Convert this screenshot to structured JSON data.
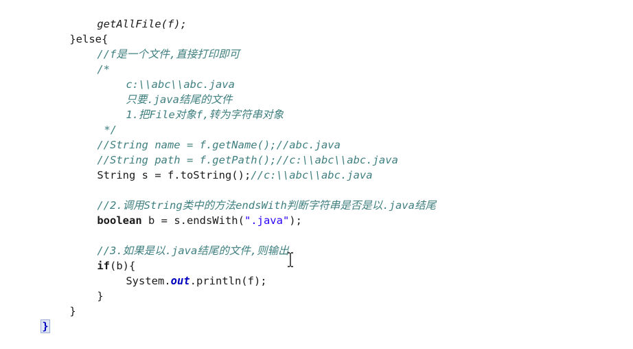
{
  "code": {
    "l1_call": "getAllFile(f);",
    "l2_else": "}else{",
    "l3_comment": "//f是一个文件,直接打印即可",
    "l4_open": "/*",
    "l5": "c:\\\\abc\\\\abc.java",
    "l6": "只要.java结尾的文件",
    "l7": "1.把File对象f,转为字符串对象",
    "l8_close": "*/",
    "l9": "//String name = f.getName();//abc.java",
    "l10": "//String path = f.getPath();//c:\\\\abc\\\\abc.java",
    "l11_code": "String s = f.toString();",
    "l11_comment": "//c:\\\\abc\\\\abc.java",
    "l13": "//2.调用String类中的方法endsWith判断字符串是否是以.java结尾",
    "l14_kw": "boolean",
    "l14_code": " b = s.endsWith(",
    "l14_str": "\".java\"",
    "l14_end": ");",
    "l16": "//3.如果是以.java结尾的文件,则输出",
    "l17_kw": "if",
    "l17_code": "(b){",
    "l18_a": "System.",
    "l18_field": "out",
    "l18_b": ".println(f);",
    "l19": "}",
    "l20": "}",
    "l21": "}"
  },
  "icons": {
    "cursor": "text-cursor-ibeam-icon"
  }
}
